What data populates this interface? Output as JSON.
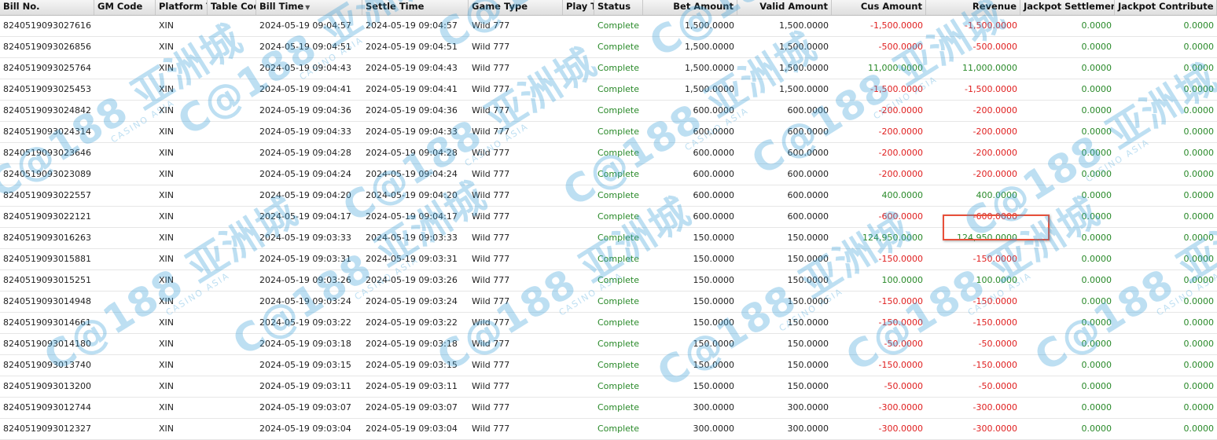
{
  "table": {
    "columns": [
      {
        "label": "Bill No.",
        "align": "left"
      },
      {
        "label": "GM Code",
        "align": "left"
      },
      {
        "label": "Platform T",
        "align": "left"
      },
      {
        "label": "Table Code",
        "align": "left"
      },
      {
        "label": "Bill Time",
        "align": "left",
        "sorted": "desc"
      },
      {
        "label": "Settle Time",
        "align": "left"
      },
      {
        "label": "Game Type",
        "align": "left"
      },
      {
        "label": "Play Ty",
        "align": "left"
      },
      {
        "label": "Status",
        "align": "left"
      },
      {
        "label": "Bet Amount",
        "align": "right"
      },
      {
        "label": "Valid Amount",
        "align": "right"
      },
      {
        "label": "Cus Amount",
        "align": "right"
      },
      {
        "label": "Revenue",
        "align": "right"
      },
      {
        "label": "Jackpot Settlement",
        "align": "right"
      },
      {
        "label": "Jackpot Contribute",
        "align": "right"
      }
    ],
    "rows": [
      [
        "8240519093027616",
        "",
        "XIN",
        "",
        "2024-05-19 09:04:57",
        "2024-05-19 09:04:57",
        "Wild 777",
        "",
        "Complete",
        "1,500.0000",
        "1,500.0000",
        "-1,500.0000",
        "-1,500.0000",
        "0.0000",
        "0.0000"
      ],
      [
        "8240519093026856",
        "",
        "XIN",
        "",
        "2024-05-19 09:04:51",
        "2024-05-19 09:04:51",
        "Wild 777",
        "",
        "Complete",
        "1,500.0000",
        "1,500.0000",
        "-500.0000",
        "-500.0000",
        "0.0000",
        "0.0000"
      ],
      [
        "8240519093025764",
        "",
        "XIN",
        "",
        "2024-05-19 09:04:43",
        "2024-05-19 09:04:43",
        "Wild 777",
        "",
        "Complete",
        "1,500.0000",
        "1,500.0000",
        "11,000.0000",
        "11,000.0000",
        "0.0000",
        "0.0000"
      ],
      [
        "8240519093025453",
        "",
        "XIN",
        "",
        "2024-05-19 09:04:41",
        "2024-05-19 09:04:41",
        "Wild 777",
        "",
        "Complete",
        "1,500.0000",
        "1,500.0000",
        "-1,500.0000",
        "-1,500.0000",
        "0.0000",
        "0.0000"
      ],
      [
        "8240519093024842",
        "",
        "XIN",
        "",
        "2024-05-19 09:04:36",
        "2024-05-19 09:04:36",
        "Wild 777",
        "",
        "Complete",
        "600.0000",
        "600.0000",
        "-200.0000",
        "-200.0000",
        "0.0000",
        "0.0000"
      ],
      [
        "8240519093024314",
        "",
        "XIN",
        "",
        "2024-05-19 09:04:33",
        "2024-05-19 09:04:33",
        "Wild 777",
        "",
        "Complete",
        "600.0000",
        "600.0000",
        "-200.0000",
        "-200.0000",
        "0.0000",
        "0.0000"
      ],
      [
        "8240519093023646",
        "",
        "XIN",
        "",
        "2024-05-19 09:04:28",
        "2024-05-19 09:04:28",
        "Wild 777",
        "",
        "Complete",
        "600.0000",
        "600.0000",
        "-200.0000",
        "-200.0000",
        "0.0000",
        "0.0000"
      ],
      [
        "8240519093023089",
        "",
        "XIN",
        "",
        "2024-05-19 09:04:24",
        "2024-05-19 09:04:24",
        "Wild 777",
        "",
        "Complete",
        "600.0000",
        "600.0000",
        "-200.0000",
        "-200.0000",
        "0.0000",
        "0.0000"
      ],
      [
        "8240519093022557",
        "",
        "XIN",
        "",
        "2024-05-19 09:04:20",
        "2024-05-19 09:04:20",
        "Wild 777",
        "",
        "Complete",
        "600.0000",
        "600.0000",
        "400.0000",
        "400.0000",
        "0.0000",
        "0.0000"
      ],
      [
        "8240519093022121",
        "",
        "XIN",
        "",
        "2024-05-19 09:04:17",
        "2024-05-19 09:04:17",
        "Wild 777",
        "",
        "Complete",
        "600.0000",
        "600.0000",
        "-600.0000",
        "-600.0000",
        "0.0000",
        "0.0000"
      ],
      [
        "8240519093016263",
        "",
        "XIN",
        "",
        "2024-05-19 09:03:33",
        "2024-05-19 09:03:33",
        "Wild 777",
        "",
        "Complete",
        "150.0000",
        "150.0000",
        "124,950.0000",
        "124,950.0000",
        "0.0000",
        "0.0000"
      ],
      [
        "8240519093015881",
        "",
        "XIN",
        "",
        "2024-05-19 09:03:31",
        "2024-05-19 09:03:31",
        "Wild 777",
        "",
        "Complete",
        "150.0000",
        "150.0000",
        "-150.0000",
        "-150.0000",
        "0.0000",
        "0.0000"
      ],
      [
        "8240519093015251",
        "",
        "XIN",
        "",
        "2024-05-19 09:03:26",
        "2024-05-19 09:03:26",
        "Wild 777",
        "",
        "Complete",
        "150.0000",
        "150.0000",
        "100.0000",
        "100.0000",
        "0.0000",
        "0.0000"
      ],
      [
        "8240519093014948",
        "",
        "XIN",
        "",
        "2024-05-19 09:03:24",
        "2024-05-19 09:03:24",
        "Wild 777",
        "",
        "Complete",
        "150.0000",
        "150.0000",
        "-150.0000",
        "-150.0000",
        "0.0000",
        "0.0000"
      ],
      [
        "8240519093014661",
        "",
        "XIN",
        "",
        "2024-05-19 09:03:22",
        "2024-05-19 09:03:22",
        "Wild 777",
        "",
        "Complete",
        "150.0000",
        "150.0000",
        "-150.0000",
        "-150.0000",
        "0.0000",
        "0.0000"
      ],
      [
        "8240519093014180",
        "",
        "XIN",
        "",
        "2024-05-19 09:03:18",
        "2024-05-19 09:03:18",
        "Wild 777",
        "",
        "Complete",
        "150.0000",
        "150.0000",
        "-50.0000",
        "-50.0000",
        "0.0000",
        "0.0000"
      ],
      [
        "8240519093013740",
        "",
        "XIN",
        "",
        "2024-05-19 09:03:15",
        "2024-05-19 09:03:15",
        "Wild 777",
        "",
        "Complete",
        "150.0000",
        "150.0000",
        "-150.0000",
        "-150.0000",
        "0.0000",
        "0.0000"
      ],
      [
        "8240519093013200",
        "",
        "XIN",
        "",
        "2024-05-19 09:03:11",
        "2024-05-19 09:03:11",
        "Wild 777",
        "",
        "Complete",
        "150.0000",
        "150.0000",
        "-50.0000",
        "-50.0000",
        "0.0000",
        "0.0000"
      ],
      [
        "8240519093012744",
        "",
        "XIN",
        "",
        "2024-05-19 09:03:07",
        "2024-05-19 09:03:07",
        "Wild 777",
        "",
        "Complete",
        "300.0000",
        "300.0000",
        "-300.0000",
        "-300.0000",
        "0.0000",
        "0.0000"
      ],
      [
        "8240519093012327",
        "",
        "XIN",
        "",
        "2024-05-19 09:03:04",
        "2024-05-19 09:03:04",
        "Wild 777",
        "",
        "Complete",
        "300.0000",
        "300.0000",
        "-300.0000",
        "-300.0000",
        "0.0000",
        "0.0000"
      ]
    ],
    "highlighted_row_index": 10,
    "highlighted_column": "Revenue"
  },
  "colors": {
    "positive": "#2a8a2a",
    "negative": "#e02020",
    "status": "#2a8a2a",
    "highlight_border": "#e8503a",
    "watermark": "#3a9fd8"
  },
  "watermark": {
    "main": "C@188 亚洲城",
    "sub": "CASINO ASIA"
  },
  "icons": {
    "sort_indicator": "sort-desc-icon"
  }
}
